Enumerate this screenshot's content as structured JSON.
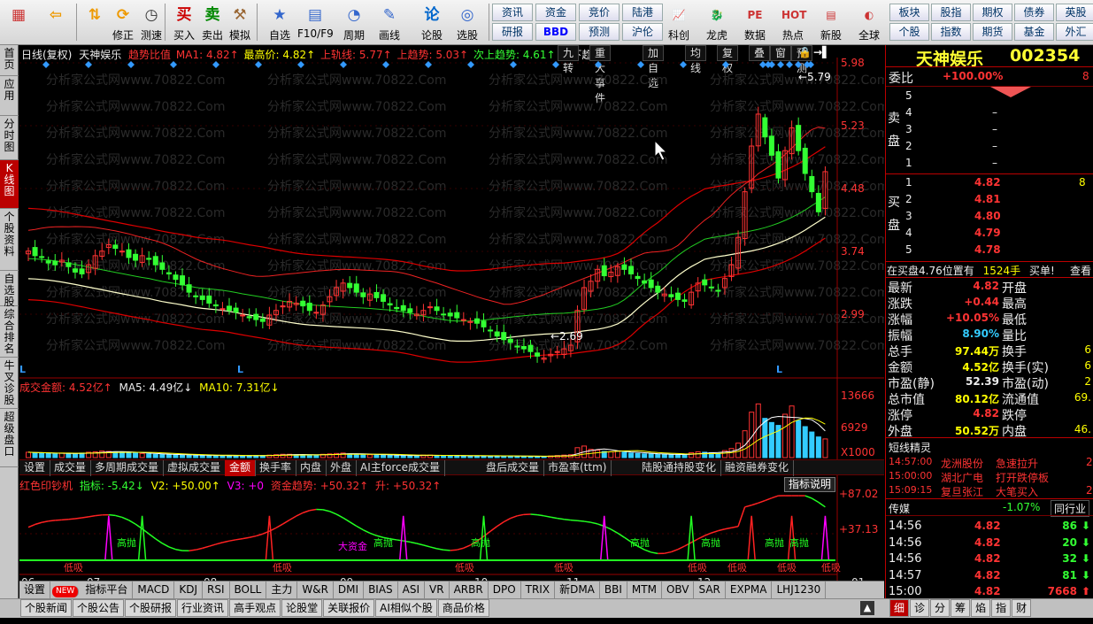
{
  "toolbar": {
    "buttons": [
      {
        "label": "",
        "icon": "app-grid-icon"
      },
      {
        "label": "",
        "icon": "back-arrow-icon"
      },
      {
        "label": "",
        "icon": "up-down-arrows-icon"
      },
      {
        "label": "修正",
        "icon": "refresh-icon"
      },
      {
        "label": "测速",
        "icon": "clock-icon"
      },
      {
        "label": "买入",
        "icon": "buy-icon",
        "glyph": "买"
      },
      {
        "label": "卖出",
        "icon": "sell-icon",
        "glyph": "卖"
      },
      {
        "label": "模拟",
        "icon": "hammer-icon"
      },
      {
        "label": "自选",
        "icon": "star-icon"
      },
      {
        "label": "F10/F9",
        "icon": "document-icon"
      },
      {
        "label": "周期",
        "icon": "cycle-icon"
      },
      {
        "label": "画线",
        "icon": "pen-icon"
      },
      {
        "label": "论股",
        "icon": "discuss-icon",
        "glyph": "论"
      },
      {
        "label": "选股",
        "icon": "select-icon"
      }
    ],
    "quick_row1": [
      "资讯",
      "资金",
      "竞价",
      "陆港"
    ],
    "quick_row2": [
      "研报",
      "BBD",
      "预测",
      "沪伦"
    ],
    "right_buttons": [
      "科创",
      "龙虎",
      "数据",
      "热点",
      "新股",
      "全球"
    ],
    "right_grid_row1": [
      "板块",
      "股指",
      "期权",
      "债券",
      "英股"
    ],
    "right_grid_row2": [
      "个股",
      "指数",
      "期货",
      "基金",
      "外汇"
    ]
  },
  "left_tabs": [
    "首页",
    "应用",
    "分时图",
    "K线图",
    "个股资料",
    "自选股",
    "综合排名",
    "牛叉诊股",
    "超级盘口"
  ],
  "chart_header": {
    "mode": "日线(复权)",
    "name": "天神娱乐",
    "trend_ratio": "趋势比值",
    "ma1": "MA1: 4.82↑",
    "highest": "最高价: 4.82↑",
    "upper_track": "上轨线: 5.77↑",
    "upper_trend": "上趋势: 5.03↑",
    "next_trend": "次上趋势: 4.61↑",
    "next_down": "次下趋"
  },
  "chart_tabs": [
    "九转",
    "重大事件",
    "加自选",
    "均线",
    "复权",
    "叠",
    "窗",
    "预测"
  ],
  "watermark": "分析家公式网www.70822.Com",
  "price_axis": [
    "5.98",
    "5.23",
    "4.48",
    "3.74",
    "2.99"
  ],
  "annotations": {
    "high": "5.79",
    "low": "2.69"
  },
  "volume_header": {
    "title": "成交金额: 4.52亿↑",
    "ma5": "MA5: 4.49亿↓",
    "ma10": "MA10: 7.31亿↓"
  },
  "volume_axis": [
    "13666",
    "6929",
    "X1000"
  ],
  "panel_tabs": [
    "设置",
    "成交量",
    "多周期成交量",
    "虚拟成交量",
    "金额",
    "换手率",
    "内盘",
    "外盘",
    "AI主force成交量",
    "盘后成交量",
    "市盈率(ttm)",
    "陆股通持股变化",
    "融资融券变化"
  ],
  "indicator_header": {
    "name": "红色印钞机",
    "main": "指标: -5.42↓",
    "v2": "V2: +50.00↑",
    "v3": "V3: +0",
    "fund": "资金趋势: +50.32↑",
    "up": "升: +50.32↑",
    "btn": "指标说明"
  },
  "indicator_axis": [
    "+87.02",
    "+37.13"
  ],
  "signal_labels": {
    "sell": "高抛",
    "buy": "低吸",
    "big": "大资金"
  },
  "months": [
    "06",
    "07",
    "08",
    "09",
    "10",
    "11",
    "12",
    "01"
  ],
  "bottom_tabs": [
    "设置",
    "NEW",
    "指标平台",
    "MACD",
    "KDJ",
    "RSI",
    "BOLL",
    "主力",
    "W&R",
    "DMI",
    "BIAS",
    "ASI",
    "VR",
    "ARBR",
    "DPO",
    "TRIX",
    "新DMA",
    "BBI",
    "MTM",
    "OBV",
    "SAR",
    "EXPMA",
    "LHJ1230"
  ],
  "bottom_bar": [
    "个股新闻",
    "个股公告",
    "个股研报",
    "行业资讯",
    "高手观点",
    "论股堂",
    "关联报价",
    "AI相似个股",
    "商品价格"
  ],
  "quote": {
    "title": "天神娱乐",
    "code": "002354",
    "weibi_label": "委比",
    "weibi": "+100.00%",
    "weibi_right": "8",
    "sell_label": "卖盘",
    "buy_label": "买盘",
    "sells": [
      {
        "n": "5",
        "p": "",
        "v": ""
      },
      {
        "n": "4",
        "p": "–",
        "v": ""
      },
      {
        "n": "3",
        "p": "–",
        "v": ""
      },
      {
        "n": "2",
        "p": "–",
        "v": ""
      },
      {
        "n": "1",
        "p": "–",
        "v": ""
      }
    ],
    "buys": [
      {
        "n": "1",
        "p": "4.82",
        "v": "8"
      },
      {
        "n": "2",
        "p": "4.81",
        "v": ""
      },
      {
        "n": "3",
        "p": "4.80",
        "v": ""
      },
      {
        "n": "4",
        "p": "4.79",
        "v": ""
      },
      {
        "n": "5",
        "p": "4.78",
        "v": ""
      }
    ],
    "pos_line": "在买盘4.76位置有",
    "pos_vol": "1524手",
    "pos_note": "买单!",
    "pos_btn": "查看",
    "stats": [
      {
        "l1": "最新",
        "v1": "4.82",
        "l2": "开盘",
        "v2": "",
        "c1": "red"
      },
      {
        "l1": "涨跌",
        "v1": "+0.44",
        "l2": "最高",
        "v2": "",
        "c1": "red"
      },
      {
        "l1": "涨幅",
        "v1": "+10.05%",
        "l2": "最低",
        "v2": "",
        "c1": "red"
      },
      {
        "l1": "振幅",
        "v1": "8.90%",
        "l2": "量比",
        "v2": "",
        "c1": "cyn"
      },
      {
        "l1": "总手",
        "v1": "97.44万",
        "l2": "换手",
        "v2": "6",
        "c1": "yel"
      },
      {
        "l1": "金额",
        "v1": "4.52亿",
        "l2": "换手(实)",
        "v2": "6",
        "c1": "yel"
      },
      {
        "l1": "市盈(静)",
        "v1": "52.39",
        "l2": "市盈(动)",
        "v2": "2",
        "c1": "wht"
      },
      {
        "l1": "总市值",
        "v1": "80.12亿",
        "l2": "流通值",
        "v2": "69.",
        "c1": "yel"
      },
      {
        "l1": "涨停",
        "v1": "4.82",
        "l2": "跌停",
        "v2": "",
        "c1": "red"
      },
      {
        "l1": "外盘",
        "v1": "50.52万",
        "l2": "内盘",
        "v2": "46.",
        "c1": "yel"
      }
    ],
    "spirit_title": "短线精灵",
    "spirit": [
      {
        "t": "14:57:00",
        "s": "龙洲股份",
        "e": "急速拉升",
        "r": "2"
      },
      {
        "t": "15:00:00",
        "s": "湖北广电",
        "e": "打开跌停板",
        "r": ""
      },
      {
        "t": "15:09:15",
        "s": "复旦张江",
        "e": "大笔买入",
        "r": "2"
      }
    ],
    "sector": {
      "name": "传媒",
      "chg": "-1.07%",
      "btn": "同行业"
    },
    "ticks": [
      {
        "t": "14:56",
        "p": "4.82",
        "v": "86",
        "d": "down"
      },
      {
        "t": "14:56",
        "p": "4.82",
        "v": "20",
        "d": "down"
      },
      {
        "t": "14:56",
        "p": "4.82",
        "v": "32",
        "d": "down"
      },
      {
        "t": "14:57",
        "p": "4.82",
        "v": "81",
        "d": "down"
      },
      {
        "t": "15:00",
        "p": "4.82",
        "v": "7668",
        "d": "up"
      }
    ],
    "bottom_tabs": [
      "细",
      "诊",
      "分",
      "筹",
      "焰",
      "指",
      "财"
    ]
  },
  "chart_data": {
    "type": "candlestick",
    "symbol": "002354",
    "price_range": [
      2.6,
      6.05
    ],
    "candles_close": [
      3.95,
      3.9,
      3.88,
      3.82,
      3.8,
      3.85,
      3.78,
      3.72,
      3.7,
      3.8,
      3.9,
      3.95,
      4.02,
      3.98,
      3.95,
      3.88,
      3.85,
      3.9,
      3.86,
      3.8,
      3.75,
      3.7,
      3.64,
      3.58,
      3.5,
      3.45,
      3.42,
      3.38,
      3.35,
      3.32,
      3.3,
      3.28,
      3.25,
      3.22,
      3.2,
      3.18,
      3.25,
      3.3,
      3.35,
      3.4,
      3.38,
      3.35,
      3.3,
      3.28,
      3.36,
      3.45,
      3.55,
      3.6,
      3.55,
      3.5,
      3.45,
      3.48,
      3.44,
      3.4,
      3.36,
      3.32,
      3.3,
      3.28,
      3.26,
      3.3,
      3.34,
      3.3,
      3.26,
      3.24,
      3.22,
      3.2,
      3.18,
      3.16,
      3.12,
      3.08,
      3.02,
      2.98,
      2.95,
      2.9,
      2.88,
      2.85,
      2.8,
      2.78,
      2.82,
      2.85,
      2.88,
      2.92,
      3.3,
      3.55,
      3.62,
      3.75,
      3.68,
      3.72,
      3.78,
      3.75,
      3.7,
      3.65,
      3.6,
      3.55,
      3.5,
      3.48,
      3.45,
      3.42,
      3.4,
      3.5,
      3.6,
      3.58,
      3.55,
      3.52,
      3.65,
      3.8,
      4.1,
      4.6,
      5.1,
      5.45,
      5.2,
      5.0,
      4.75,
      5.05,
      5.3,
      5.05,
      4.8,
      4.6,
      4.38,
      4.82
    ],
    "volume_range": [
      0,
      15000
    ],
    "volume_amounts": [
      1300,
      1200,
      1100,
      1000,
      900,
      1100,
      1000,
      900,
      1100,
      1300,
      1400,
      1600,
      1500,
      1400,
      1300,
      1200,
      1100,
      1000,
      900,
      800,
      800,
      700,
      700,
      600,
      600,
      600,
      500,
      500,
      500,
      500,
      500,
      500,
      500,
      500,
      500,
      500,
      600,
      700,
      800,
      800,
      700,
      700,
      600,
      600,
      800,
      900,
      1000,
      1100,
      900,
      800,
      800,
      700,
      700,
      600,
      600,
      500,
      500,
      500,
      500,
      600,
      600,
      500,
      500,
      500,
      500,
      400,
      400,
      400,
      400,
      400,
      400,
      400,
      400,
      300,
      300,
      300,
      300,
      300,
      400,
      500,
      600,
      700,
      2400,
      2800,
      2000,
      1800,
      1500,
      1400,
      1600,
      1300,
      1100,
      1000,
      900,
      900,
      800,
      800,
      700,
      700,
      700,
      1200,
      1400,
      1300,
      1200,
      1000,
      1700,
      2200,
      3500,
      6500,
      11000,
      13000,
      9500,
      8500,
      7800,
      10500,
      12500,
      9000,
      7500,
      6200,
      5000,
      4520
    ],
    "indicator_range": [
      0,
      95
    ]
  }
}
